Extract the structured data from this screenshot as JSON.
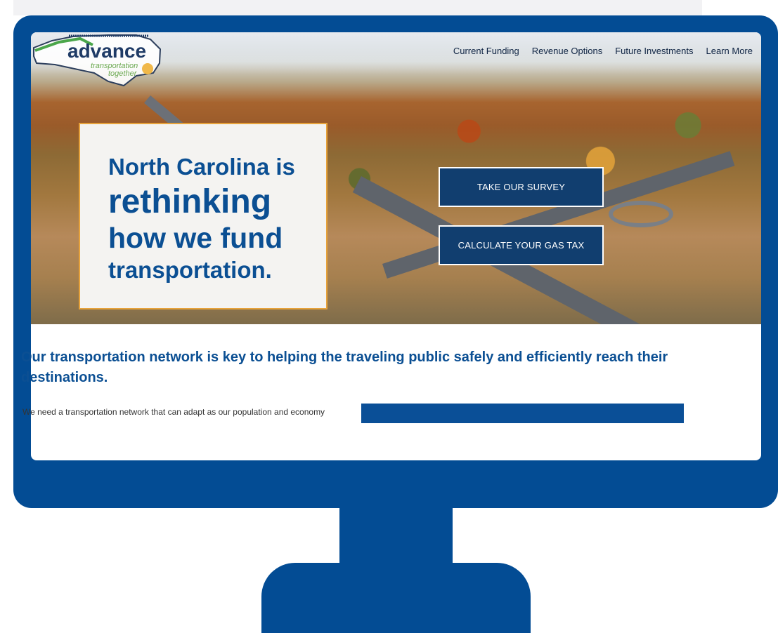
{
  "logo": {
    "name": "advance",
    "tagline1": "transportation",
    "tagline2": "together"
  },
  "nav": {
    "items": [
      "Current Funding",
      "Revenue Options",
      "Future Investments",
      "Learn More"
    ]
  },
  "hero": {
    "line1": "North Carolina is",
    "line2": "rethinking",
    "line3": "how we fund",
    "line4": "transportation.",
    "buttons": {
      "survey": "TAKE OUR SURVEY",
      "gas": "CALCULATE YOUR GAS TAX"
    }
  },
  "content": {
    "heading": "Our transportation network is key to helping the traveling public safely and efficiently reach their destinations.",
    "body": "We need a transportation network that can adapt as our population and economy"
  },
  "colors": {
    "monitor": "#034c94",
    "brand_blue": "#0b4f93",
    "button_bg": "#113e6f",
    "card_border": "#e7a23a",
    "card_bg": "#f4f3f1"
  }
}
